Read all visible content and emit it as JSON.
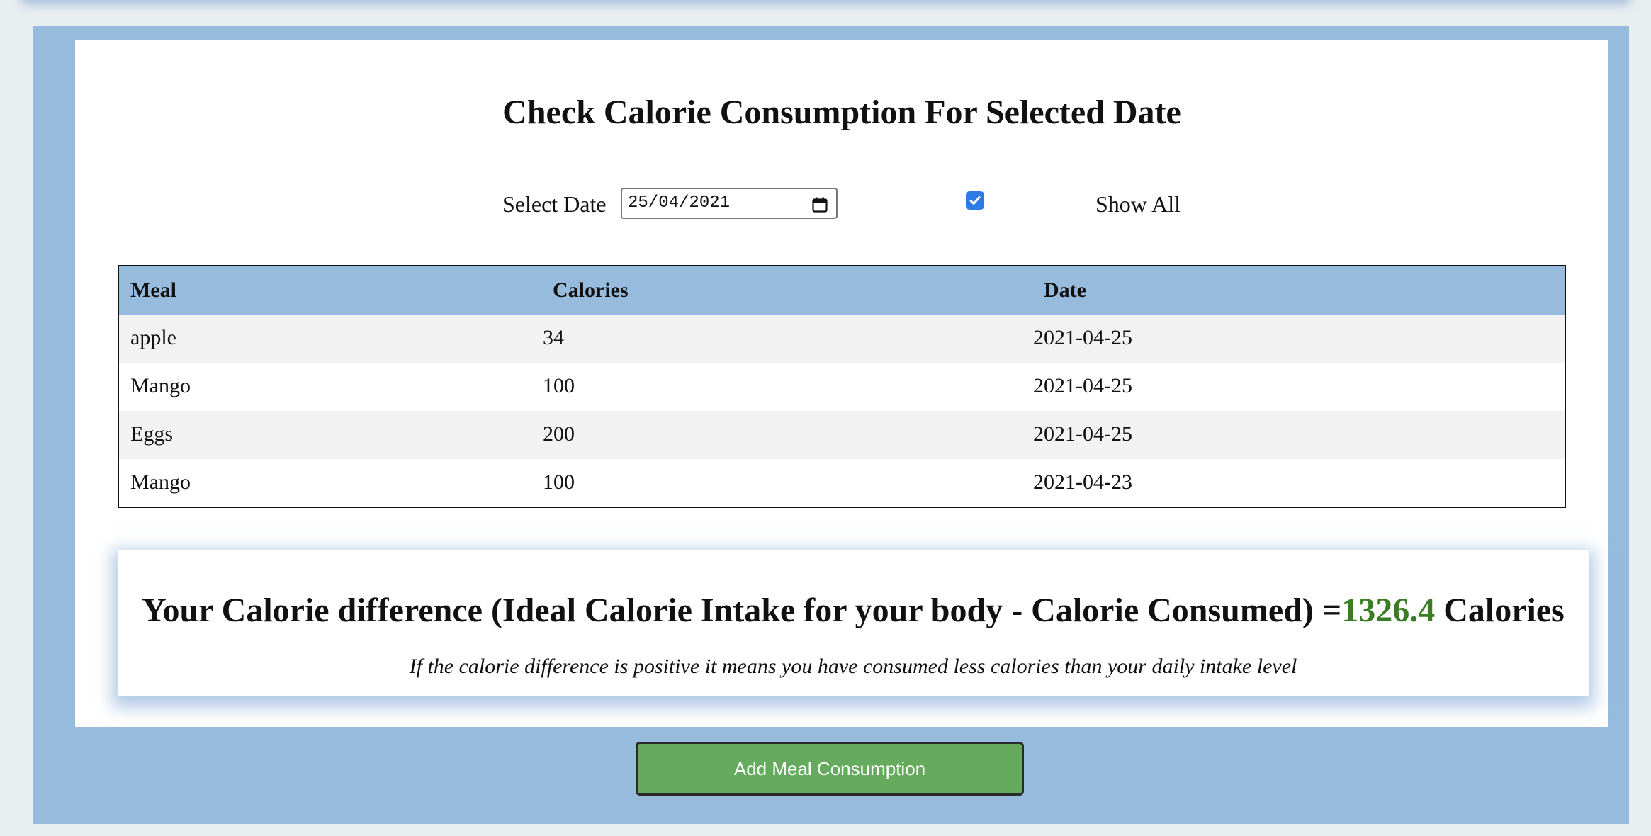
{
  "page": {
    "title": "Check Calorie Consumption For Selected Date"
  },
  "filters": {
    "date_label": "Select Date",
    "date_value": "25/04/2021",
    "show_all_checked": true,
    "show_all_label": "Show All"
  },
  "table": {
    "headers": [
      "Meal",
      "Calories",
      "Date"
    ],
    "rows": [
      [
        "apple",
        "34",
        "2021-04-25"
      ],
      [
        "Mango",
        "100",
        "2021-04-25"
      ],
      [
        "Eggs",
        "200",
        "2021-04-25"
      ],
      [
        "Mango",
        "100",
        "2021-04-23"
      ]
    ]
  },
  "summary": {
    "prefix": "Your Calorie difference (Ideal Calorie Intake for your body - Calorie Consumed) =",
    "value": "1326.4",
    "suffix": " Calories",
    "note": "If the calorie difference is positive it means you have consumed less calories than your daily intake level"
  },
  "actions": {
    "add_meal_label": "Add Meal Consumption"
  },
  "colors": {
    "panel_blue": "#96bbdc",
    "checkbox_blue": "#2f7be6",
    "value_green": "#3a7d25",
    "button_green": "#66ab5d"
  },
  "icons": {
    "calendar": "calendar-icon",
    "check": "checkmark-icon"
  }
}
